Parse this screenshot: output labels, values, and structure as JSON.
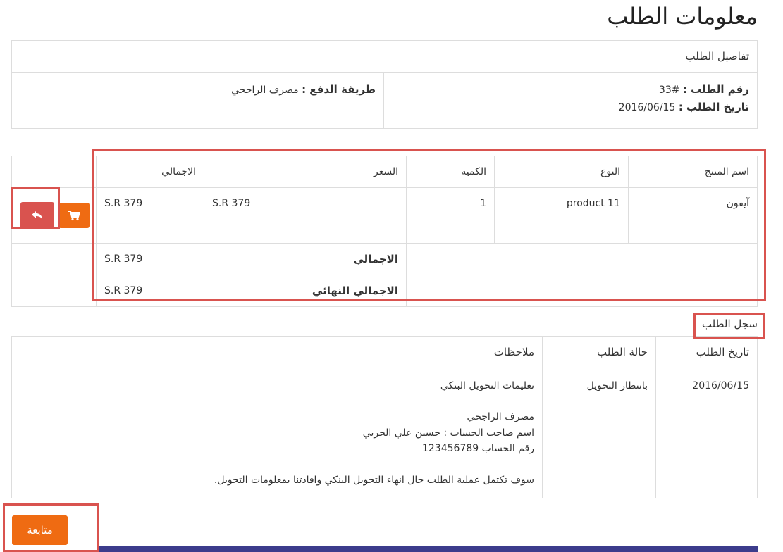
{
  "page_title": "معلومات الطلب",
  "details": {
    "caption": "تفاصيل الطلب",
    "order_number_label": "رقم الطلب :",
    "order_number_value": "#33",
    "order_date_label": "تاريخ الطلب :",
    "order_date_value": "2016/06/15",
    "payment_method_label": "طريقة الدفع :",
    "payment_method_value": "مصرف الراجحي"
  },
  "products": {
    "headers": [
      "اسم المنتج",
      "النوع",
      "الكمية",
      "السعر",
      "الاجمالي"
    ],
    "rows": [
      {
        "name": "آيفون",
        "type": "product 11",
        "qty": "1",
        "price": "S.R 379",
        "total": "S.R 379"
      }
    ],
    "subtotal_label": "الاجمالي",
    "subtotal_value": "S.R 379",
    "grand_total_label": "الاجمالي النهائي",
    "grand_total_value": "S.R 379",
    "icons": {
      "return": "reply-icon",
      "cart": "cart-icon"
    }
  },
  "history": {
    "title": "سجل الطلب",
    "headers": [
      "تاريخ الطلب",
      "حالة الطلب",
      "ملاحظات"
    ],
    "row": {
      "date": "2016/06/15",
      "status": "بانتظار التحويل",
      "notes": [
        "تعليمات التحويل البنكي",
        "",
        "مصرف الراجحي",
        "اسم صاحب الحساب : حسين علي الحربي",
        "رقم الحساب 123456789",
        "",
        "سوف تكتمل عملية الطلب حال انهاء التحويل البنكي وافادتنا بمعلومات التحويل."
      ]
    }
  },
  "continue_button": "متابعة",
  "colors": {
    "accent": "#ef6b12",
    "danger": "#d9534f",
    "border": "#dddddd",
    "footer": "#3c3c8c"
  }
}
